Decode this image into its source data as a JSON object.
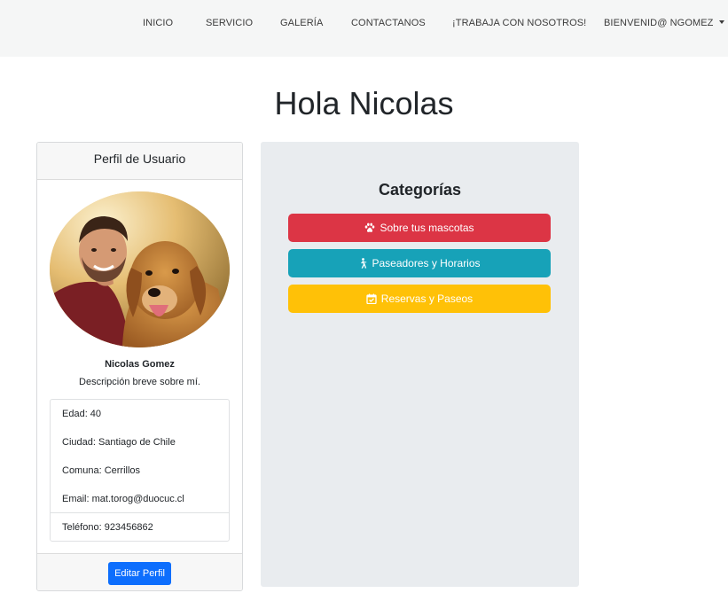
{
  "navbar": {
    "items": [
      {
        "label": "INICIO"
      },
      {
        "label": "SERVICIO"
      },
      {
        "label": "GALERÍA"
      },
      {
        "label": "CONTACTANOS"
      },
      {
        "label": "¡TRABAJA CON NOSOTROS!"
      },
      {
        "label": "BIENVENID@ NGOMEZ"
      }
    ]
  },
  "page": {
    "title": "Hola Nicolas"
  },
  "profile": {
    "header": "Perfil de Usuario",
    "name": "Nicolas Gomez",
    "description": "Descripción breve sobre mí.",
    "info": {
      "age": "Edad: 40",
      "city": "Ciudad: Santiago de Chile",
      "commune": "Comuna: Cerrillos",
      "email": "Email: mat.torog@duocuc.cl",
      "phone": "Teléfono: 923456862"
    },
    "edit_label": "Editar Perfil"
  },
  "categories": {
    "title": "Categorías",
    "items": [
      {
        "label": "Sobre tus mascotas",
        "icon": "paw-icon",
        "color": "#dc3545"
      },
      {
        "label": "Paseadores y Horarios",
        "icon": "walking-person-icon",
        "color": "#17a2b8"
      },
      {
        "label": "Reservas y Paseos",
        "icon": "calendar-check-icon",
        "color": "#ffc107"
      }
    ]
  },
  "colors": {
    "primary": "#0d6efd",
    "navbar_bg": "#f5f6f6",
    "panel_bg": "#e9ecef"
  }
}
